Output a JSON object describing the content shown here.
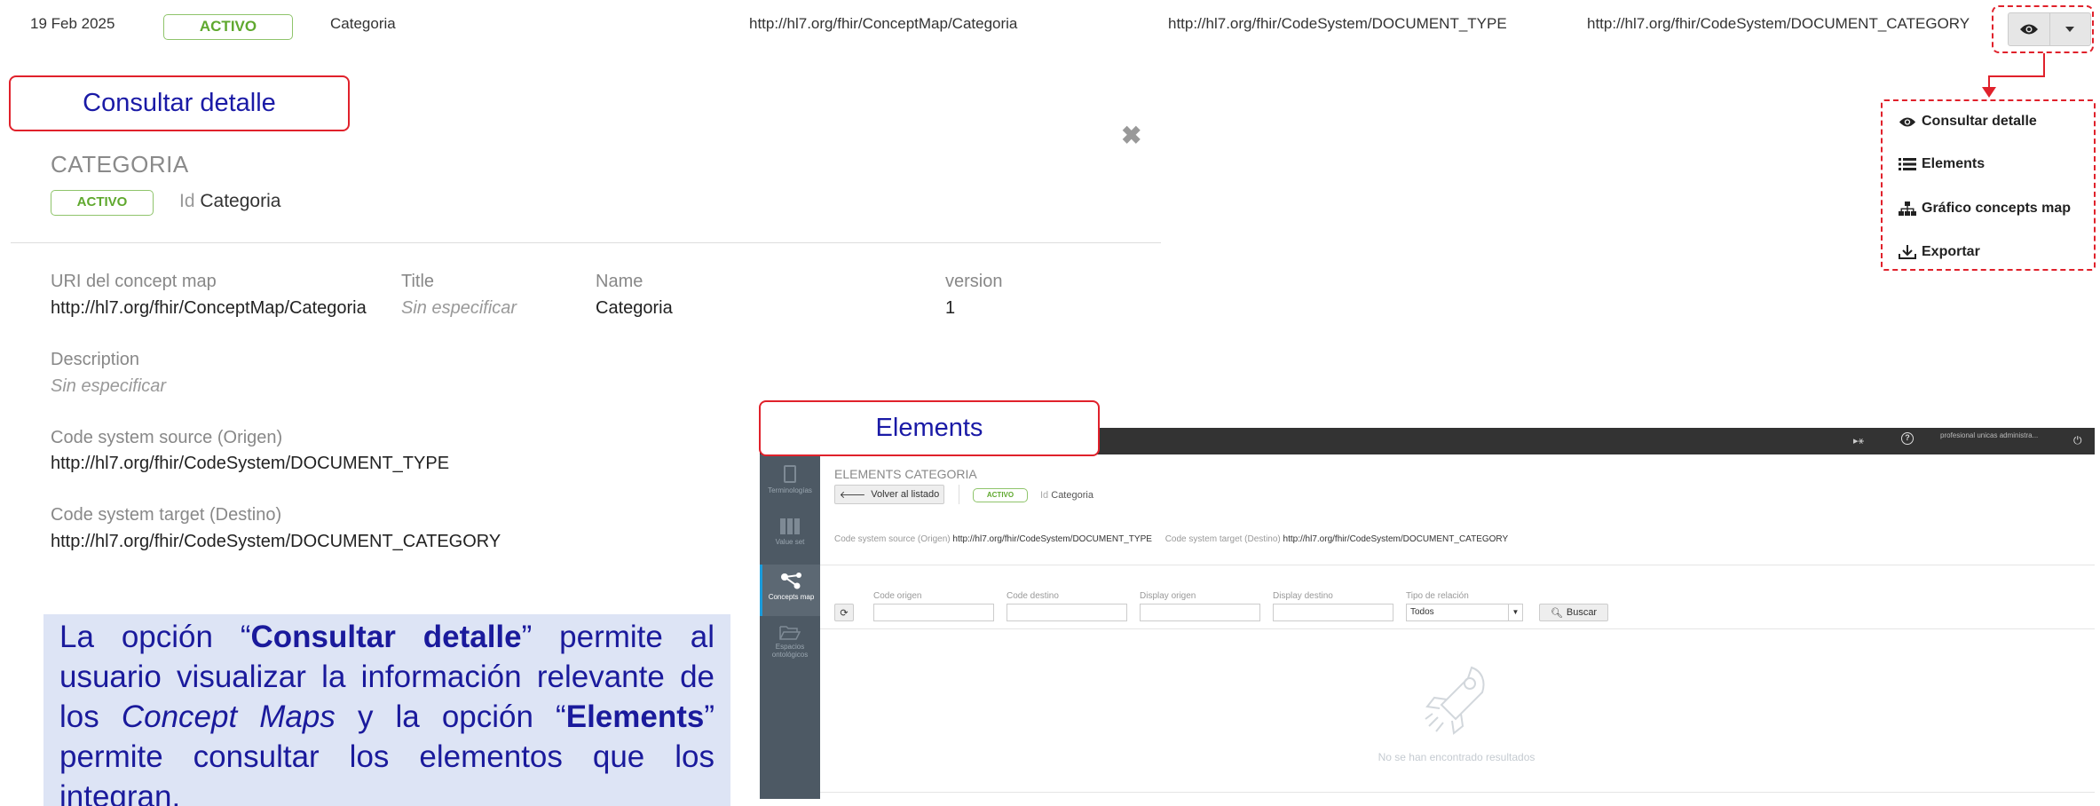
{
  "top_row": {
    "date": "19 Feb 2025",
    "status": "ACTIVO",
    "name": "Categoria",
    "concept_map_url": "http://hl7.org/fhir/ConceptMap/Categoria",
    "source_url": "http://hl7.org/fhir/CodeSystem/DOCUMENT_TYPE",
    "target_url": "http://hl7.org/fhir/CodeSystem/DOCUMENT_CATEGORY"
  },
  "callouts": {
    "detail": "Consultar detalle",
    "elements": "Elements"
  },
  "detail": {
    "title": "CATEGORIA",
    "status": "ACTIVO",
    "id_label": "Id",
    "id_value": "Categoria",
    "fields": {
      "uri_label": "URI del concept map",
      "uri_value": "http://hl7.org/fhir/ConceptMap/Categoria",
      "title_label": "Title",
      "title_value": "Sin especificar",
      "name_label": "Name",
      "name_value": "Categoria",
      "version_label": "version",
      "version_value": "1",
      "description_label": "Description",
      "description_value": "Sin especificar",
      "source_label": "Code system source (Origen)",
      "source_value": "http://hl7.org/fhir/CodeSystem/DOCUMENT_TYPE",
      "target_label": "Code system target (Destino)",
      "target_value": "http://hl7.org/fhir/CodeSystem/DOCUMENT_CATEGORY"
    }
  },
  "menu": {
    "items": [
      {
        "label": "Consultar detalle",
        "icon": "eye-icon"
      },
      {
        "label": "Elements",
        "icon": "list-icon"
      },
      {
        "label": "Gráfico concepts map",
        "icon": "sitemap-icon"
      },
      {
        "label": "Exportar",
        "icon": "download-icon"
      }
    ]
  },
  "description": {
    "t1": "La opción “",
    "b1": "Consultar detalle",
    "t2": "” permite al usuario visualizar la información relevante de los ",
    "i1": "Concept Maps",
    "t3": " y la opción “",
    "b2": "Elements",
    "t4": "” permite consultar los elementos que los integran."
  },
  "elements_screen": {
    "user": "profesional unicas administra...",
    "sidebar": [
      "Terminologías",
      "Value set",
      "Concepts map",
      "Espacios ontológicos"
    ],
    "title": "ELEMENTS CATEGORIA",
    "back_button": "Volver al listado",
    "status": "ACTIVO",
    "id_label": "Id",
    "id_value": "Categoria",
    "source_label": "Code system source (Origen)",
    "source_value": "http://hl7.org/fhir/CodeSystem/DOCUMENT_TYPE",
    "target_label": "Code system target (Destino)",
    "target_value": "http://hl7.org/fhir/CodeSystem/DOCUMENT_CATEGORY",
    "filters": {
      "code_origen": "Code origen",
      "code_destino": "Code destino",
      "display_origen": "Display origen",
      "display_destino": "Display destino",
      "tipo_relacion": "Tipo de relación",
      "tipo_value": "Todos",
      "search_button": "Buscar"
    },
    "empty_message": "No se han encontrado resultados"
  },
  "colors": {
    "highlight_red": "#e0212b",
    "callout_text": "#1a1aa6",
    "status_green": "#5fa82e",
    "description_bg": "#dde4f5",
    "sidebar_bg": "#4d5964"
  }
}
